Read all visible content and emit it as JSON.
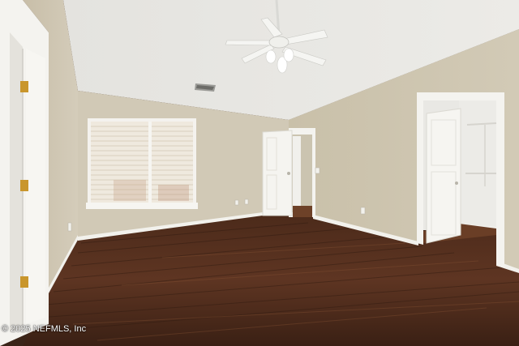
{
  "photo": {
    "scene": "empty bedroom with vaulted ceiling, ceiling fan, window with blinds, dark wood floor, open closet door",
    "watermark": "© 2025 NEFMLS, Inc"
  },
  "colors": {
    "ceiling": "#e7e6e2",
    "wall_left": "#cfc6b2",
    "wall_back": "#d3cbb9",
    "wall_right": "#cbc3ad",
    "trim": "#f4f3ef",
    "floor_dark": "#3b2215",
    "floor_mid": "#5c3623",
    "floor_light": "#7a4a30",
    "closet_interior": "#e9e8e4",
    "window_light": "#f3f1ec",
    "hinge": "#c9962c"
  }
}
